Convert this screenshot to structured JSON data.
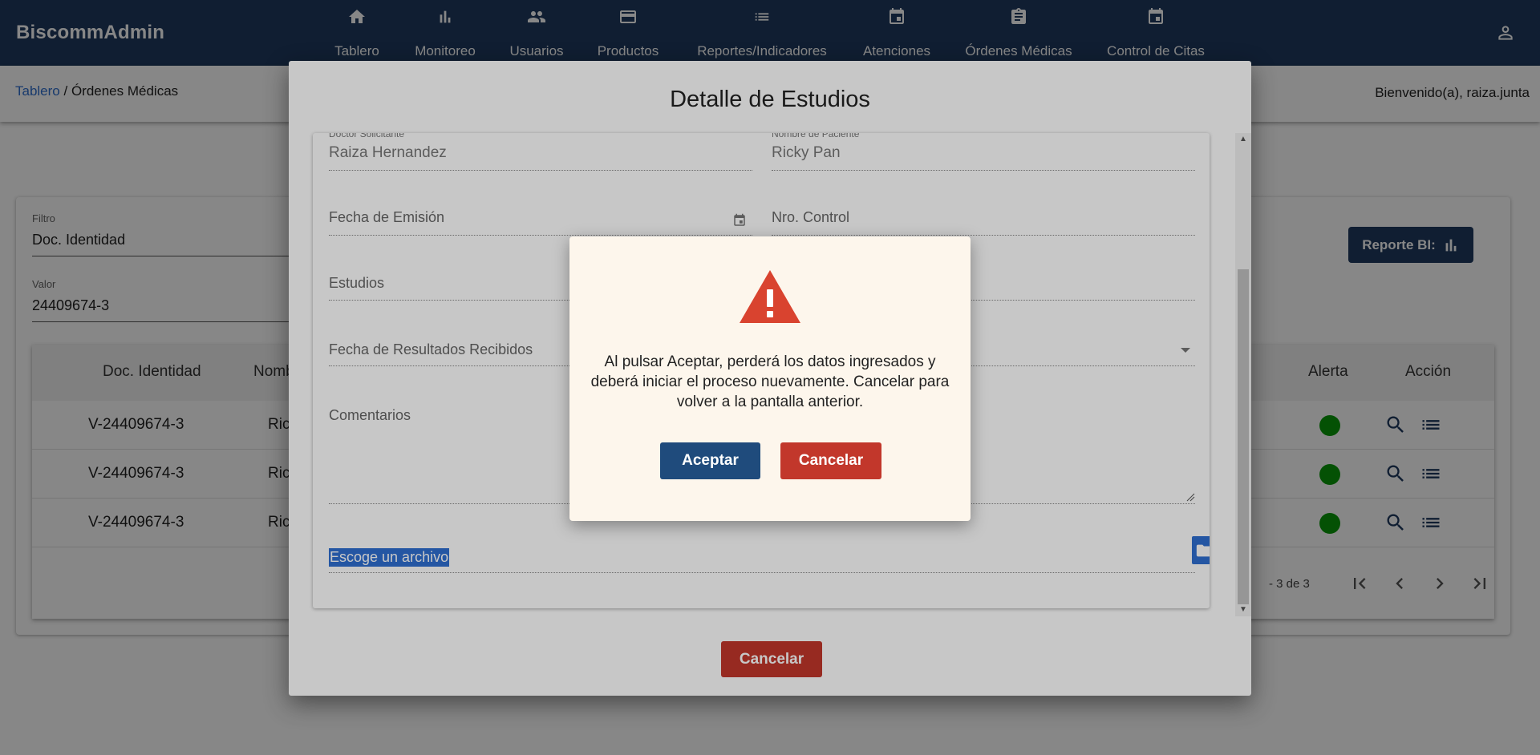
{
  "app": {
    "title": "BiscommAdmin"
  },
  "nav": {
    "items": [
      {
        "label": "Tablero",
        "icon": "home-icon"
      },
      {
        "label": "Monitoreo",
        "icon": "bar-chart-icon"
      },
      {
        "label": "Usuarios",
        "icon": "people-icon"
      },
      {
        "label": "Productos",
        "icon": "credit-card-icon"
      },
      {
        "label": "Reportes/Indicadores",
        "icon": "list-icon"
      },
      {
        "label": "Atenciones",
        "icon": "calendar-icon"
      },
      {
        "label": "Órdenes Médicas",
        "icon": "clipboard-icon"
      },
      {
        "label": "Control de Citas",
        "icon": "calendar-icon"
      }
    ],
    "user_icon": "account-icon"
  },
  "breadcrumb": {
    "root": "Tablero",
    "separator": " / ",
    "current": "Órdenes Médicas"
  },
  "welcome": "Bienvenido(a), raiza.junta",
  "filter": {
    "filter_label": "Filtro",
    "filter_value": "Doc. Identidad",
    "value_label": "Valor",
    "value_value": "24409674-3",
    "report_button": "Reporte BI:"
  },
  "table": {
    "headers": {
      "doc": "Doc. Identidad",
      "name": "Nombre",
      "alert": "Alerta",
      "action": "Acción"
    },
    "rows": [
      {
        "doc": "V-24409674-3",
        "name": "Ric",
        "alert_color": "#0a9a0a"
      },
      {
        "doc": "V-24409674-3",
        "name": "Ric",
        "alert_color": "#0a9a0a"
      },
      {
        "doc": "V-24409674-3",
        "name": "Ric",
        "alert_color": "#0a9a0a"
      }
    ],
    "pager_text": "- 3 de 3"
  },
  "modal": {
    "title": "Detalle de Estudios",
    "doctor_label": "Doctor Solicitante",
    "doctor_value": "Raiza Hernandez",
    "patient_label": "Nombre de Paciente",
    "patient_value": "Ricky Pan",
    "fecha_emision_label": "Fecha de Emisión",
    "nro_control_label": "Nro. Control",
    "estudios_label": "Estudios",
    "fecha_resultados_label": "Fecha de Resultados Recibidos",
    "comentarios_label": "Comentarios",
    "file_label": "Escoge un archivo",
    "cancel_button": "Cancelar"
  },
  "alert": {
    "message": "Al pulsar Aceptar, perderá los datos ingresados y deberá iniciar el proceso nuevamente. Cancelar para volver a la pantalla anterior.",
    "accept_button": "Aceptar",
    "cancel_button": "Cancelar",
    "icon": "warning-icon"
  },
  "colors": {
    "navbar": "#1f3a5f",
    "accept": "#1f4b7c",
    "cancel": "#c2372b",
    "warning": "#d9432f",
    "link": "#2f6fcf"
  }
}
